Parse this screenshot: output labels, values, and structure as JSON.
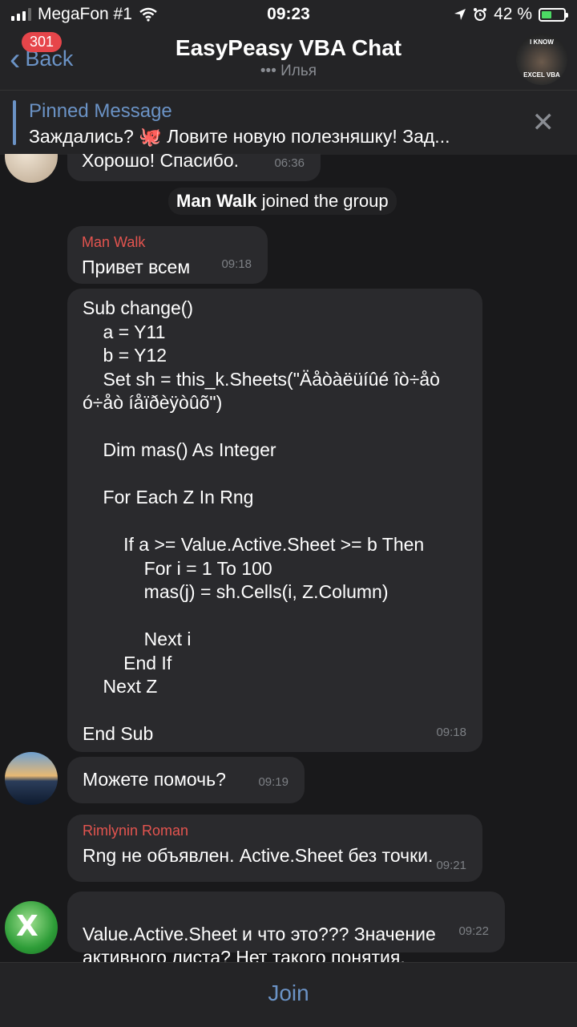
{
  "status": {
    "carrier": "MegaFon #1",
    "time": "09:23",
    "battery": "42 %"
  },
  "header": {
    "back_badge": "301",
    "back_label": "Back",
    "title": "EasyPeasy VBA Chat",
    "subtitle": "••• Илья",
    "avatar_text_top": "I KNOW",
    "avatar_text_bottom": "EXCEL VBA"
  },
  "pinned": {
    "title": "Pinned Message",
    "text": "Заждались? 🐙 Ловите новую полезняшку! Зад..."
  },
  "messages": {
    "m1": {
      "text": "Хорошо! Спасибо.",
      "time": "06:36"
    },
    "service": {
      "name": "Man Walk",
      "action": "joined the group"
    },
    "m2": {
      "sender": "Man Walk",
      "text": "Привет всем",
      "time": "09:18"
    },
    "m3": {
      "code": "Sub change()\n    a = Y11\n    b = Y12\n    Set sh = this_k.Sheets(\"Äåòàëüíûé îò÷åò\nó÷åò íåïðèÿòûõ\")\n\n    Dim mas() As Integer\n\n    For Each Z In Rng\n\n        If a >= Value.Active.Sheet >= b Then\n            For i = 1 To 100\n            mas(j) = sh.Cells(i, Z.Column)\n\n            Next i\n        End If\n    Next Z\n\nEnd Sub",
      "time": "09:18"
    },
    "m4": {
      "text": "Можете помочь?",
      "time": "09:19"
    },
    "m5": {
      "sender": "Rimlynin Roman",
      "text": "Rng не объявлен. Active.Sheet без точки.",
      "time": "09:21"
    },
    "m6": {
      "text": "Value.Active.Sheet и что это??? Значение\nактивного листа? Нет такого понятия.",
      "time": "09:22"
    }
  },
  "footer": {
    "join_label": "Join"
  },
  "colors": {
    "accent": "#6b93c6",
    "sender_name": "#e3544f",
    "bubble": "#2a2a2d",
    "background": "#19191b",
    "badge": "#e6454a"
  }
}
